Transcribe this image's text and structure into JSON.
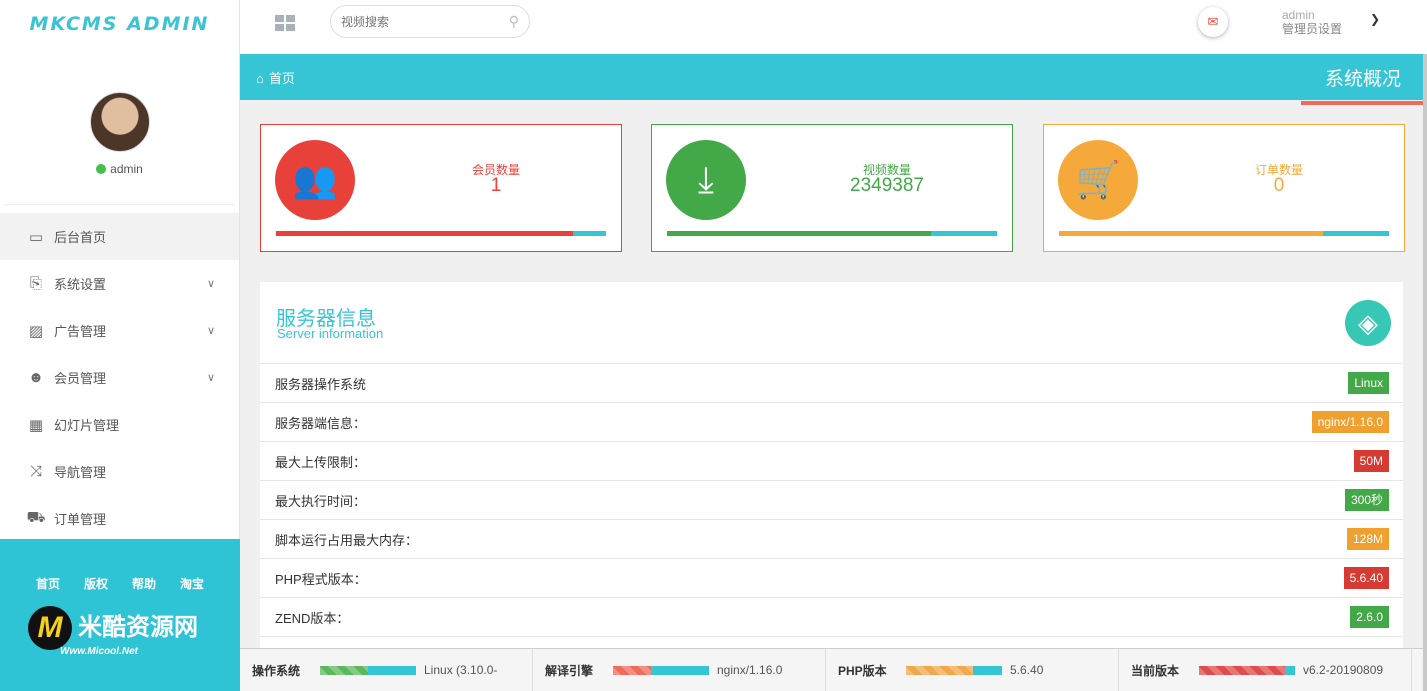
{
  "sidebar": {
    "logo": "MKCMS ADMIN",
    "user": "admin",
    "items": [
      {
        "label": "后台首页",
        "icon": "laptop-icon",
        "glyph": "▭",
        "dropdown": false
      },
      {
        "label": "系统设置",
        "icon": "clipboard-icon",
        "glyph": "⎘",
        "dropdown": true
      },
      {
        "label": "广告管理",
        "icon": "image-icon",
        "glyph": "▨",
        "dropdown": true
      },
      {
        "label": "会员管理",
        "icon": "users-icon",
        "glyph": "☻",
        "dropdown": true
      },
      {
        "label": "幻灯片管理",
        "icon": "table-icon",
        "glyph": "▦",
        "dropdown": false
      },
      {
        "label": "导航管理",
        "icon": "shuffle-icon",
        "glyph": "⤨",
        "dropdown": false
      },
      {
        "label": "订单管理",
        "icon": "cart-icon",
        "glyph": "⛟",
        "dropdown": false
      }
    ],
    "footer_links": [
      "首页",
      "版权",
      "帮助",
      "淘宝"
    ],
    "brand_title": "米酷资源网",
    "brand_sub": "Www.Micool.Net",
    "brand_logo": "M"
  },
  "topbar": {
    "search_placeholder": "视频搜索",
    "admin_name": "admin",
    "admin_role": "管理员设置"
  },
  "crumb": {
    "home": "首页",
    "overview": "系统概况"
  },
  "stats": [
    {
      "label": "会员数量",
      "value": "1",
      "color": "#e8413a",
      "icon": "users-icon",
      "glyph": "👥",
      "progress": 0.9
    },
    {
      "label": "视频数量",
      "value": "2349387",
      "color": "#43a847",
      "icon": "download-icon",
      "glyph": "⤓",
      "progress": 0.8
    },
    {
      "label": "订单数量",
      "value": "0",
      "color": "#f5a93a",
      "icon": "cart-icon",
      "glyph": "🛒",
      "progress": 0.8
    }
  ],
  "server": {
    "title": "服务器信息",
    "subtitle": "Server information",
    "rows": [
      {
        "label": "服务器操作系统",
        "value": "Linux",
        "color": "#43a847"
      },
      {
        "label": "服务器端信息：",
        "value": "nginx/1.16.0",
        "color": "#f0a02e"
      },
      {
        "label": "最大上传限制：",
        "value": "50M",
        "color": "#d53a33"
      },
      {
        "label": "最大执行时间：",
        "value": "300秒",
        "color": "#43a847"
      },
      {
        "label": "脚本运行占用最大内存：",
        "value": "128M",
        "color": "#f0a02e"
      },
      {
        "label": "PHP程式版本：",
        "value": "5.6.40",
        "color": "#d53a33"
      },
      {
        "label": "ZEND版本：",
        "value": "2.6.0",
        "color": "#43a847"
      }
    ]
  },
  "bottombar": [
    {
      "label": "操作系统",
      "value": "Linux (3.10.0-",
      "color": "#5cb85c",
      "progress": 0.5
    },
    {
      "label": "解译引擎",
      "value": "nginx/1.16.0",
      "color": "#ef6b5a",
      "progress": 0.4
    },
    {
      "label": "PHP版本",
      "value": "5.6.40",
      "color": "#f0a84a",
      "progress": 0.7
    },
    {
      "label": "当前版本",
      "value": "v6.2-20190809",
      "color": "#e04b4b",
      "progress": 0.9
    }
  ]
}
